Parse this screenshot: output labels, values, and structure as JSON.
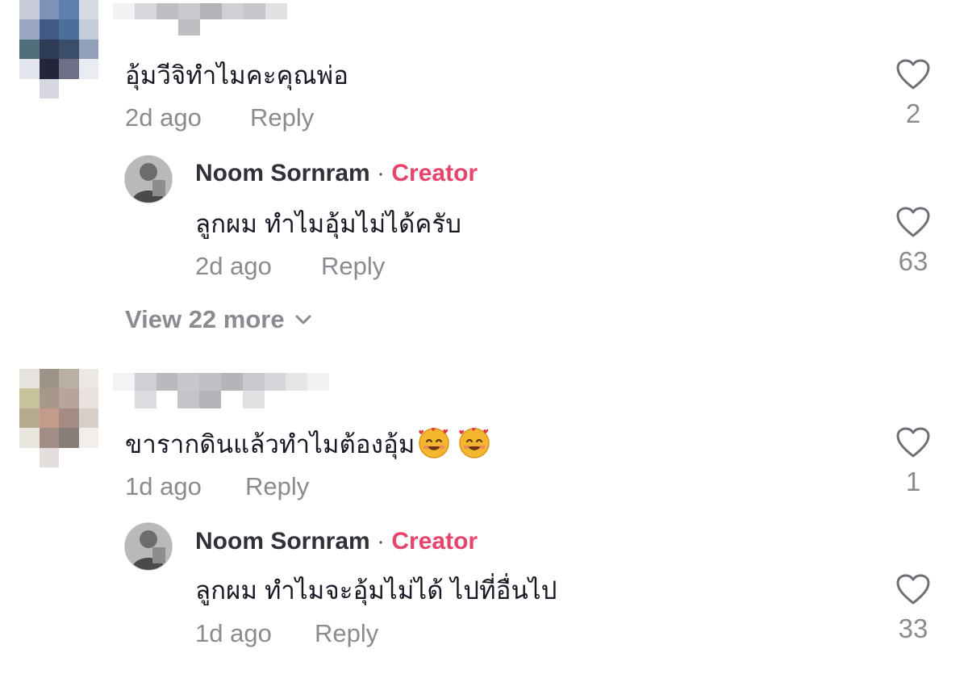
{
  "comments": [
    {
      "text": "อุ้มวีจิทำไมคะคุณพ่อ",
      "time": "2d ago",
      "reply_label": "Reply",
      "likes": "2",
      "reply": {
        "author": "Noom Sornram",
        "separator": "·",
        "badge": "Creator",
        "text": "ลูกผม ทำไมอุ้มไม่ได้ครับ",
        "time": "2d ago",
        "reply_label": "Reply",
        "likes": "63"
      },
      "view_more": "View 22 more"
    },
    {
      "text": "ขารากดินแล้วทำไมต้องอุ้ม",
      "emojis": [
        "smiling-face-with-hearts",
        "smiling-face-with-hearts"
      ],
      "time": "1d ago",
      "reply_label": "Reply",
      "likes": "1",
      "reply": {
        "author": "Noom Sornram",
        "separator": "·",
        "badge": "Creator",
        "text": "ลูกผม ทำไมจะอุ้มไม่ได้ ไปที่อื่นไป",
        "time": "1d ago",
        "reply_label": "Reply",
        "likes": "33"
      }
    }
  ],
  "icons": {
    "like": "heart-outline-icon",
    "expand": "chevron-down-icon"
  },
  "colors": {
    "creator_badge": "#e6446a",
    "meta_text": "#8a8b91",
    "primary_text": "#161823"
  }
}
